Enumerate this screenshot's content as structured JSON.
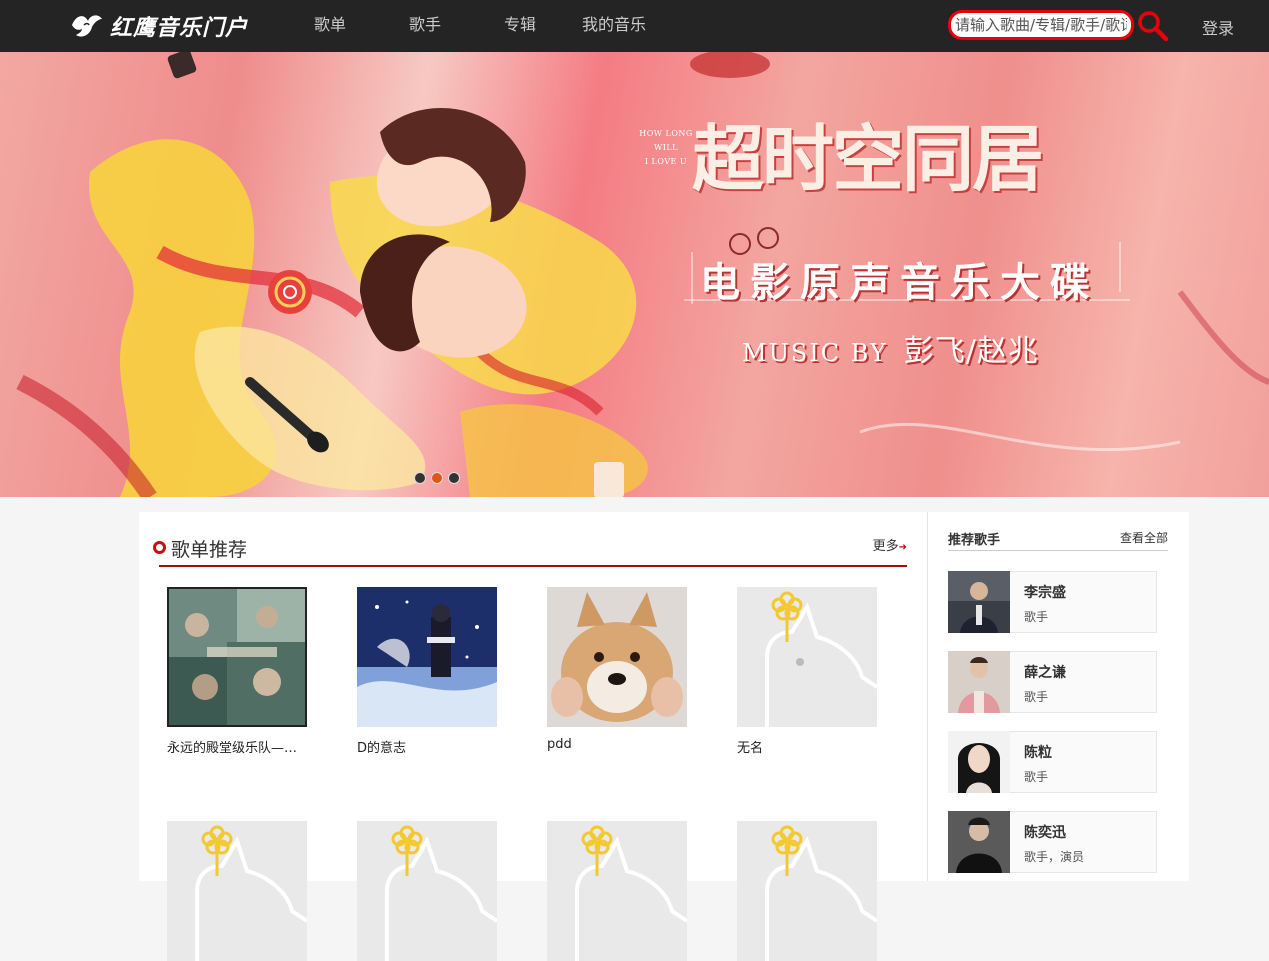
{
  "brand": {
    "name": "红鹰音乐门户"
  },
  "nav": {
    "items": [
      {
        "label": "歌单"
      },
      {
        "label": "歌手"
      },
      {
        "label": "专辑"
      },
      {
        "label": "我的音乐"
      }
    ],
    "search_placeholder": "请输入歌曲/专辑/歌手/歌词",
    "login_label": "登录"
  },
  "banner": {
    "eng_line1": "HOW LONG",
    "eng_line2": "WILL",
    "eng_line3": "I LOVE U",
    "title": "超时空同居",
    "subtitle": "电影原声音乐大碟",
    "credit_en": "MUSIC BY",
    "credit_names": "彭飞/赵兆",
    "active_slide": 1,
    "slide_count": 3
  },
  "playlists": {
    "title": "歌单推荐",
    "more_label": "更多",
    "items": [
      {
        "name": "永远的殿堂级乐队——Beyond"
      },
      {
        "name": "D的意志"
      },
      {
        "name": "pdd"
      },
      {
        "name": "无名"
      },
      {
        "name": ""
      },
      {
        "name": ""
      },
      {
        "name": ""
      },
      {
        "name": ""
      }
    ]
  },
  "artists": {
    "title": "推荐歌手",
    "view_all_label": "查看全部",
    "items": [
      {
        "name": "李宗盛",
        "role": "歌手"
      },
      {
        "name": "薛之谦",
        "role": "歌手"
      },
      {
        "name": "陈粒",
        "role": "歌手"
      },
      {
        "name": "陈奕迅",
        "role": "歌手，演员"
      }
    ]
  },
  "colors": {
    "topbar_bg": "#242424",
    "accent_red": "#c20c0c",
    "search_border": "#e8000b",
    "dot_active": "#e2541a"
  }
}
